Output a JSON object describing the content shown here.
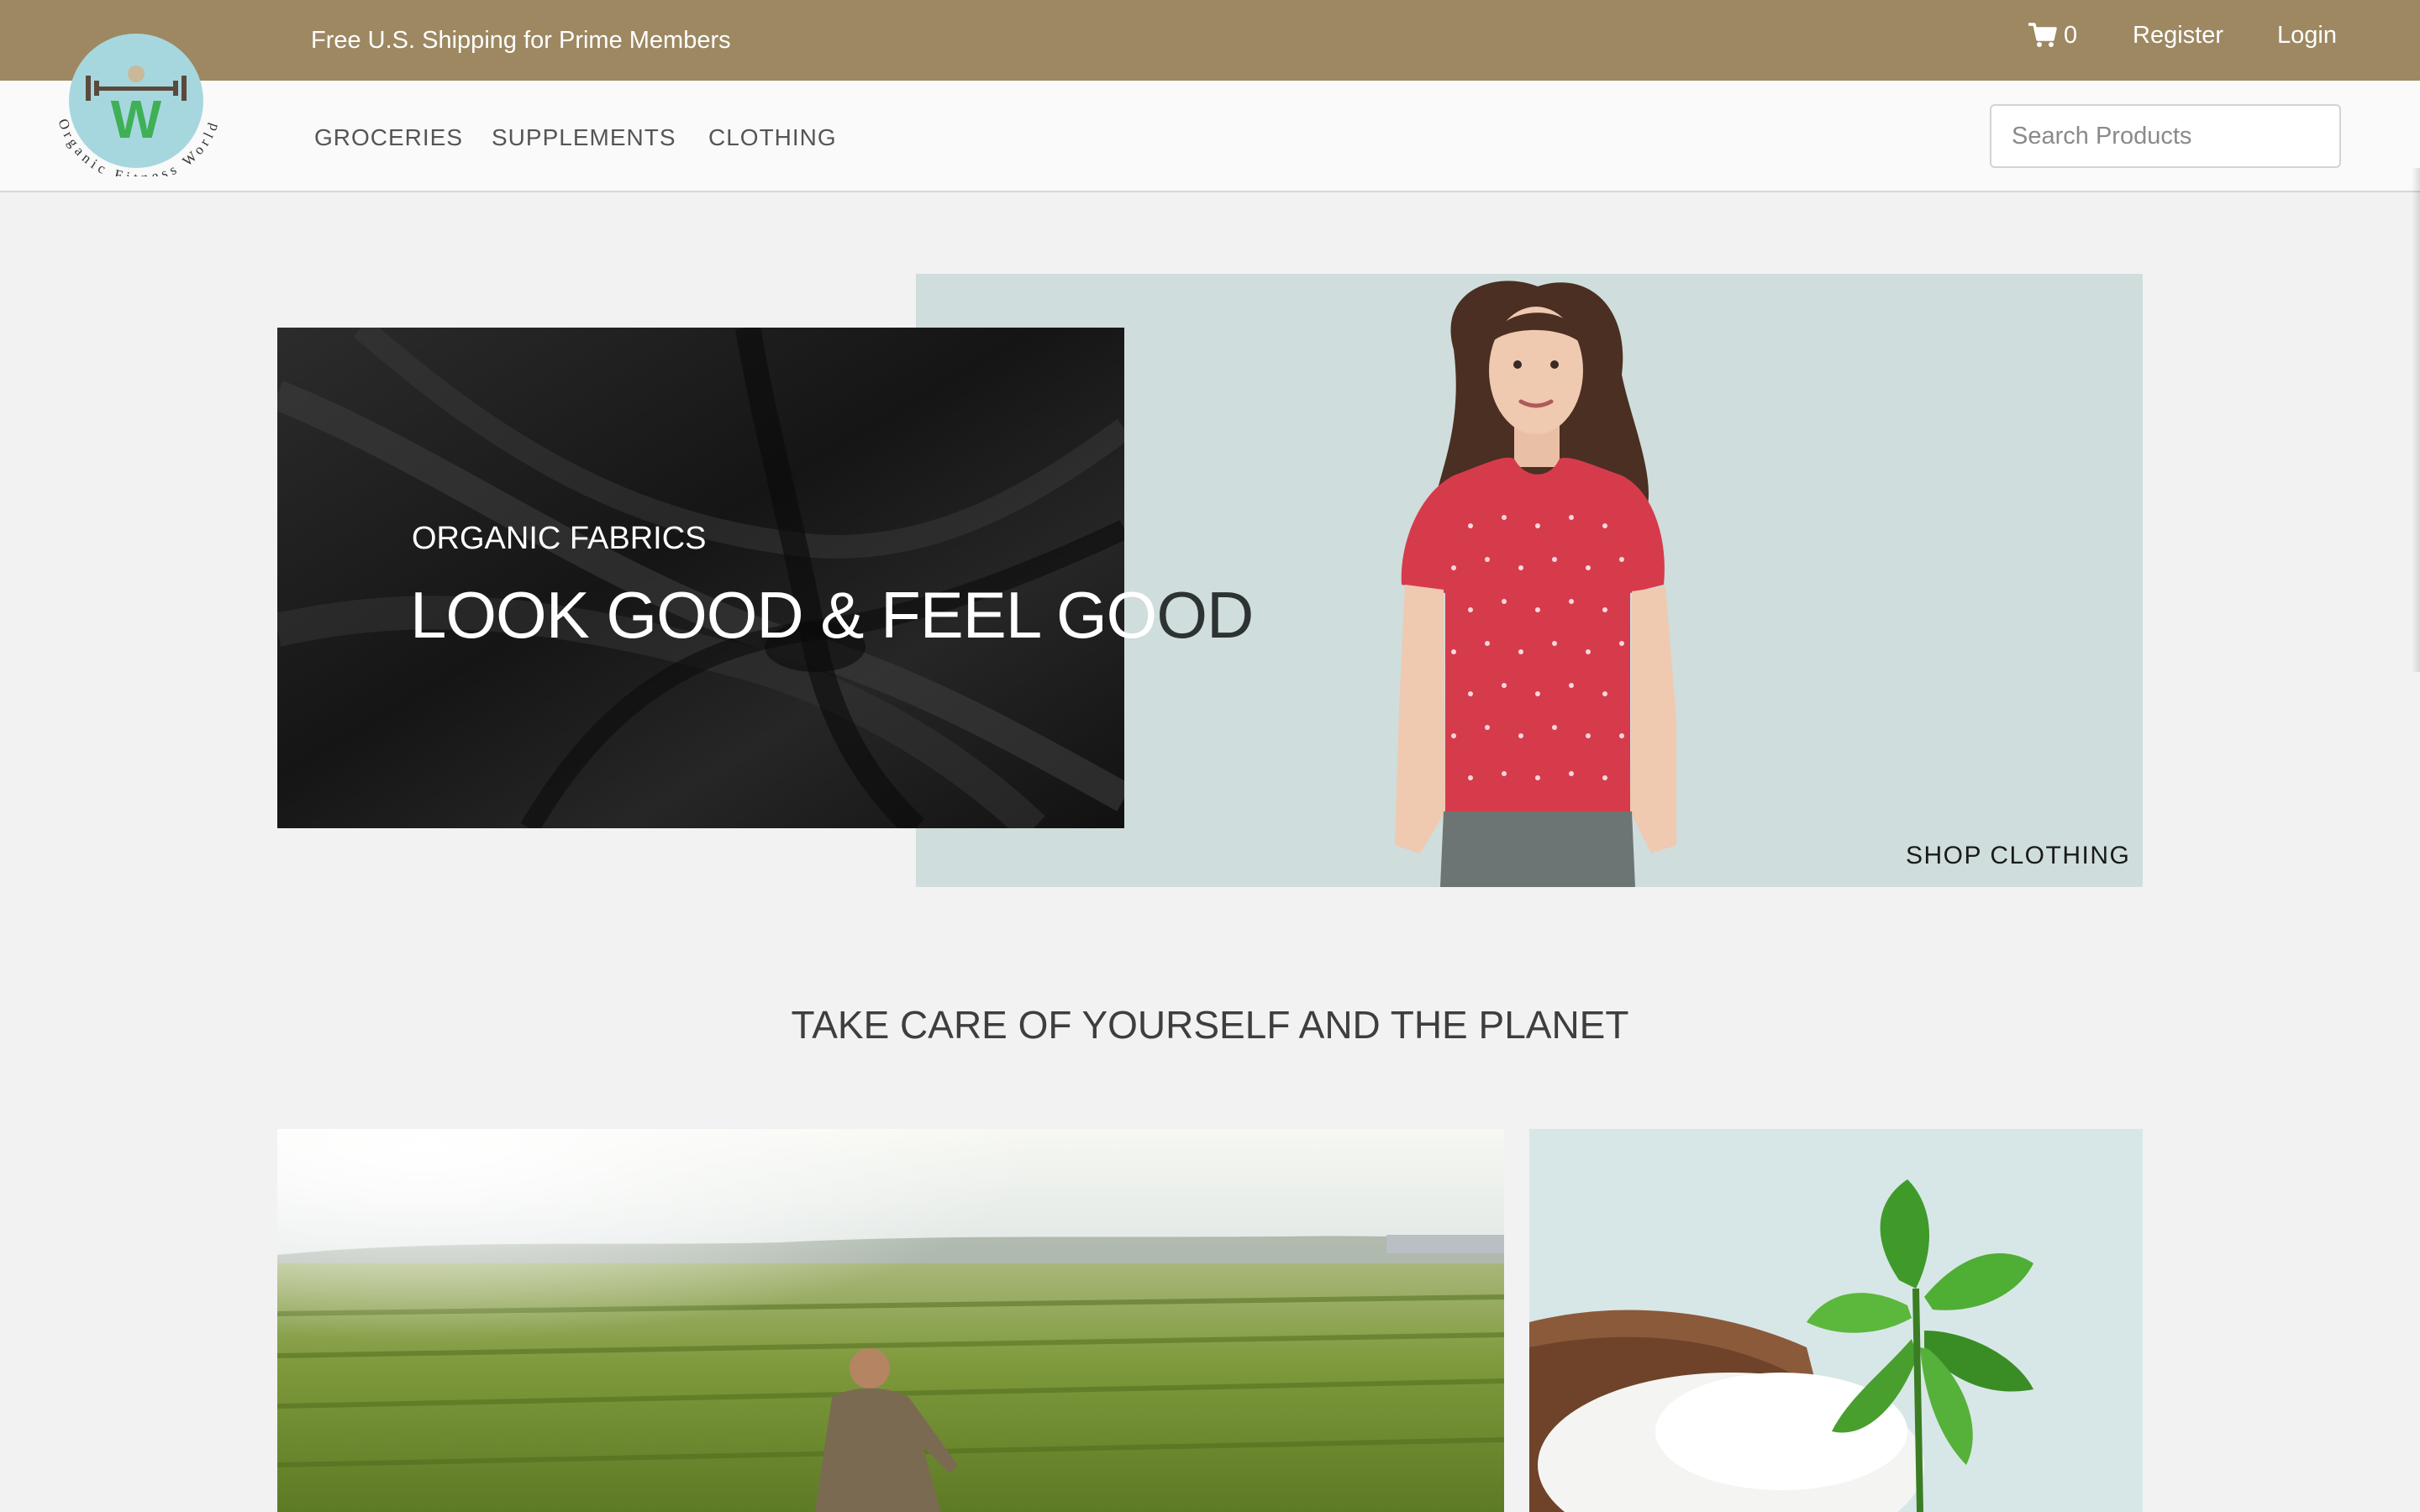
{
  "brand": {
    "name": "Organic Fitness World",
    "logo_letter": "W"
  },
  "topbar": {
    "promo": "Free U.S. Shipping for Prime Members",
    "cart_count": "0",
    "register_label": "Register",
    "login_label": "Login"
  },
  "nav": {
    "items": [
      {
        "label": "GROCERIES"
      },
      {
        "label": "SUPPLEMENTS"
      },
      {
        "label": "CLOTHING"
      }
    ],
    "search_placeholder": "Search Products"
  },
  "hero": {
    "kicker": "ORGANIC FABRICS",
    "headline_light": "LOOK GOOD & FEEL GO",
    "headline_dark": "OD",
    "cta": "SHOP CLOTHING"
  },
  "tagline": "TAKE CARE OF YOURSELF AND THE PLANET",
  "colors": {
    "topbar": "#9d8862",
    "hero_panel": "#cfdddc",
    "page_bg": "#f2f2f2"
  },
  "icons": {
    "cart": "shopping-cart-icon"
  }
}
